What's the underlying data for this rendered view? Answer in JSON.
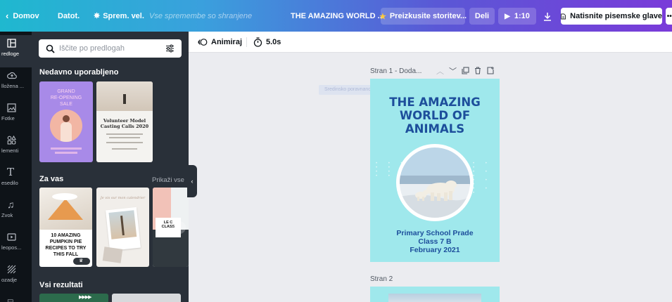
{
  "topbar": {
    "home": "Domov",
    "file": "Datot.",
    "resize": "Sprem. vel.",
    "save_status": "Vse spremembe so shranjene",
    "doc_title": "THE AMAZING WORLD ...",
    "try_button": "Preizkusite storitev...",
    "share_button": "Deli",
    "play_time": "1:10",
    "print_button": "Natisnite pisemske glave",
    "accent": "#7a3bd9"
  },
  "rail": [
    {
      "label": "redloge",
      "icon": "templates-icon"
    },
    {
      "label": "lložena ...",
      "icon": "uploads-icon"
    },
    {
      "label": "Fotke",
      "icon": "photos-icon"
    },
    {
      "label": "lementi",
      "icon": "elements-icon"
    },
    {
      "label": "esedilo",
      "icon": "text-icon"
    },
    {
      "label": "Zvok",
      "icon": "audio-icon"
    },
    {
      "label": "leopos...",
      "icon": "video-icon"
    },
    {
      "label": "ozadje",
      "icon": "background-icon"
    }
  ],
  "panel": {
    "search_placeholder": "Iščite po predlogah",
    "recent_title": "Nedavno uporabljeno",
    "for_you_title": "Za vas",
    "see_all": "Prikaži vse",
    "all_results_title": "Vsi rezultati",
    "recent_thumbs": [
      {
        "line1": "GRAND",
        "line2": "RE-OPENING",
        "line3": "SALE"
      },
      {
        "line1": "Volunteer Model",
        "line2": "Casting Calls 2020"
      }
    ],
    "for_you_thumbs": [
      {
        "text": "10 AMAZING PUMPKIN PIE RECIPES TO TRY THIS FALL"
      },
      {
        "text": "Je vis sur mon calendrier"
      },
      {
        "text": "LE C CLASS"
      }
    ]
  },
  "toolbar": {
    "animate": "Animiraj",
    "duration": "5.0s"
  },
  "canvas": {
    "page1_label": "Stran 1 - Doda...",
    "page2_label": "Stran 2",
    "ghost_label": "Sredinsko poravnano",
    "page_bg": "#9fe8ec",
    "heading_line1": "THE AMAZING",
    "heading_line2": "WORLD OF",
    "heading_line3": "ANIMALS",
    "footer_line1": "Primary School Prade",
    "footer_line2": "Class 7 B",
    "footer_line3": "February 2021"
  }
}
